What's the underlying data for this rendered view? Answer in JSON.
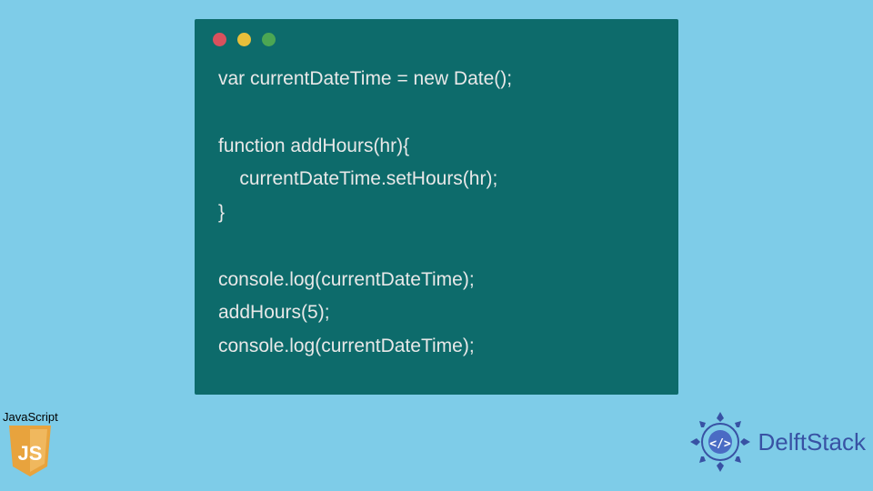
{
  "code": {
    "lines": [
      "var currentDateTime = new Date();",
      "",
      "function addHours(hr){",
      "    currentDateTime.setHours(hr);",
      "}",
      "",
      "console.log(currentDateTime);",
      "addHours(5);",
      "console.log(currentDateTime);"
    ]
  },
  "js_badge": {
    "label": "JavaScript",
    "shield_text": "JS"
  },
  "brand": {
    "name": "DelftStack"
  },
  "colors": {
    "background": "#7ecce8",
    "editor_bg": "#0d6b6b",
    "code_text": "#e8e8e8",
    "js_yellow": "#e8a33d",
    "brand_blue": "#3852a4"
  }
}
